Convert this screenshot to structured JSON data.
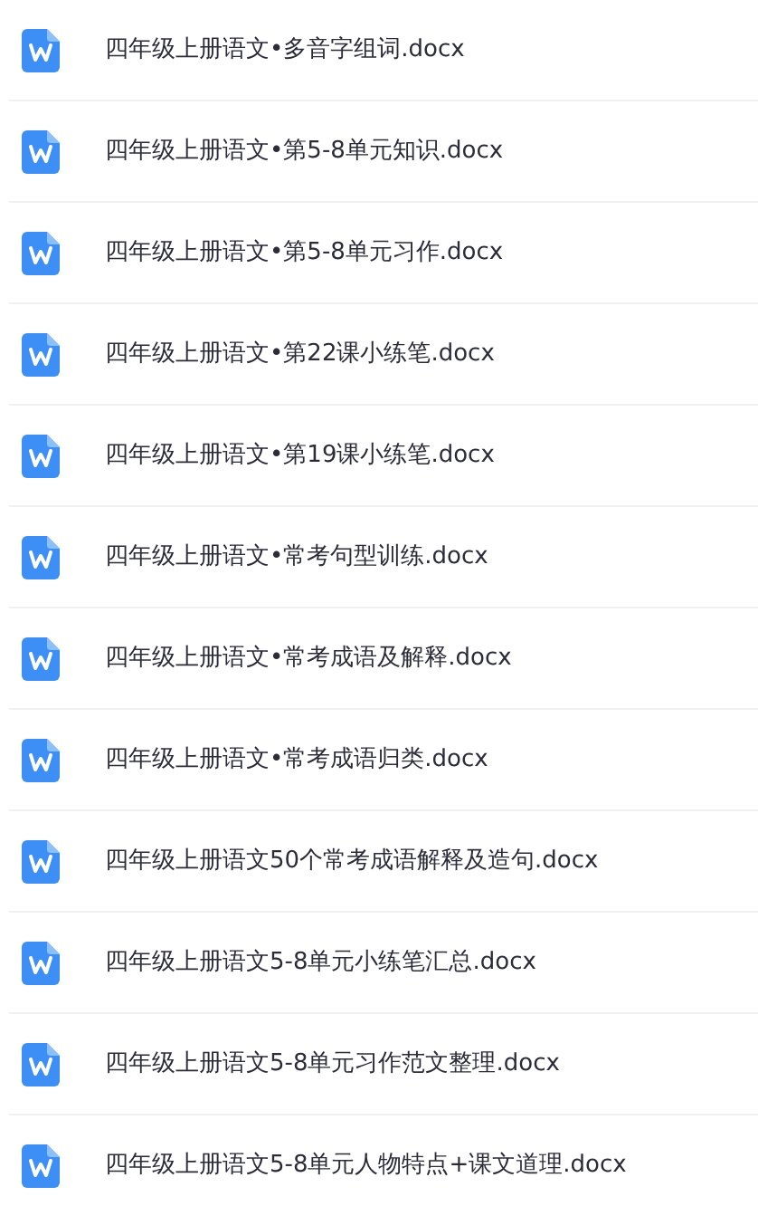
{
  "files": [
    {
      "name": "四年级上册语文•多音字组词.docx"
    },
    {
      "name": "四年级上册语文•第5-8单元知识.docx"
    },
    {
      "name": "四年级上册语文•第5-8单元习作.docx"
    },
    {
      "name": "四年级上册语文•第22课小练笔.docx"
    },
    {
      "name": "四年级上册语文•第19课小练笔.docx"
    },
    {
      "name": "四年级上册语文•常考句型训练.docx"
    },
    {
      "name": "四年级上册语文•常考成语及解释.docx"
    },
    {
      "name": "四年级上册语文•常考成语归类.docx"
    },
    {
      "name": "四年级上册语文50个常考成语解释及造句.docx"
    },
    {
      "name": "四年级上册语文5-8单元小练笔汇总.docx"
    },
    {
      "name": "四年级上册语文5-8单元习作范文整理.docx"
    },
    {
      "name": "四年级上册语文5-8单元人物特点+课文道理.docx"
    }
  ]
}
